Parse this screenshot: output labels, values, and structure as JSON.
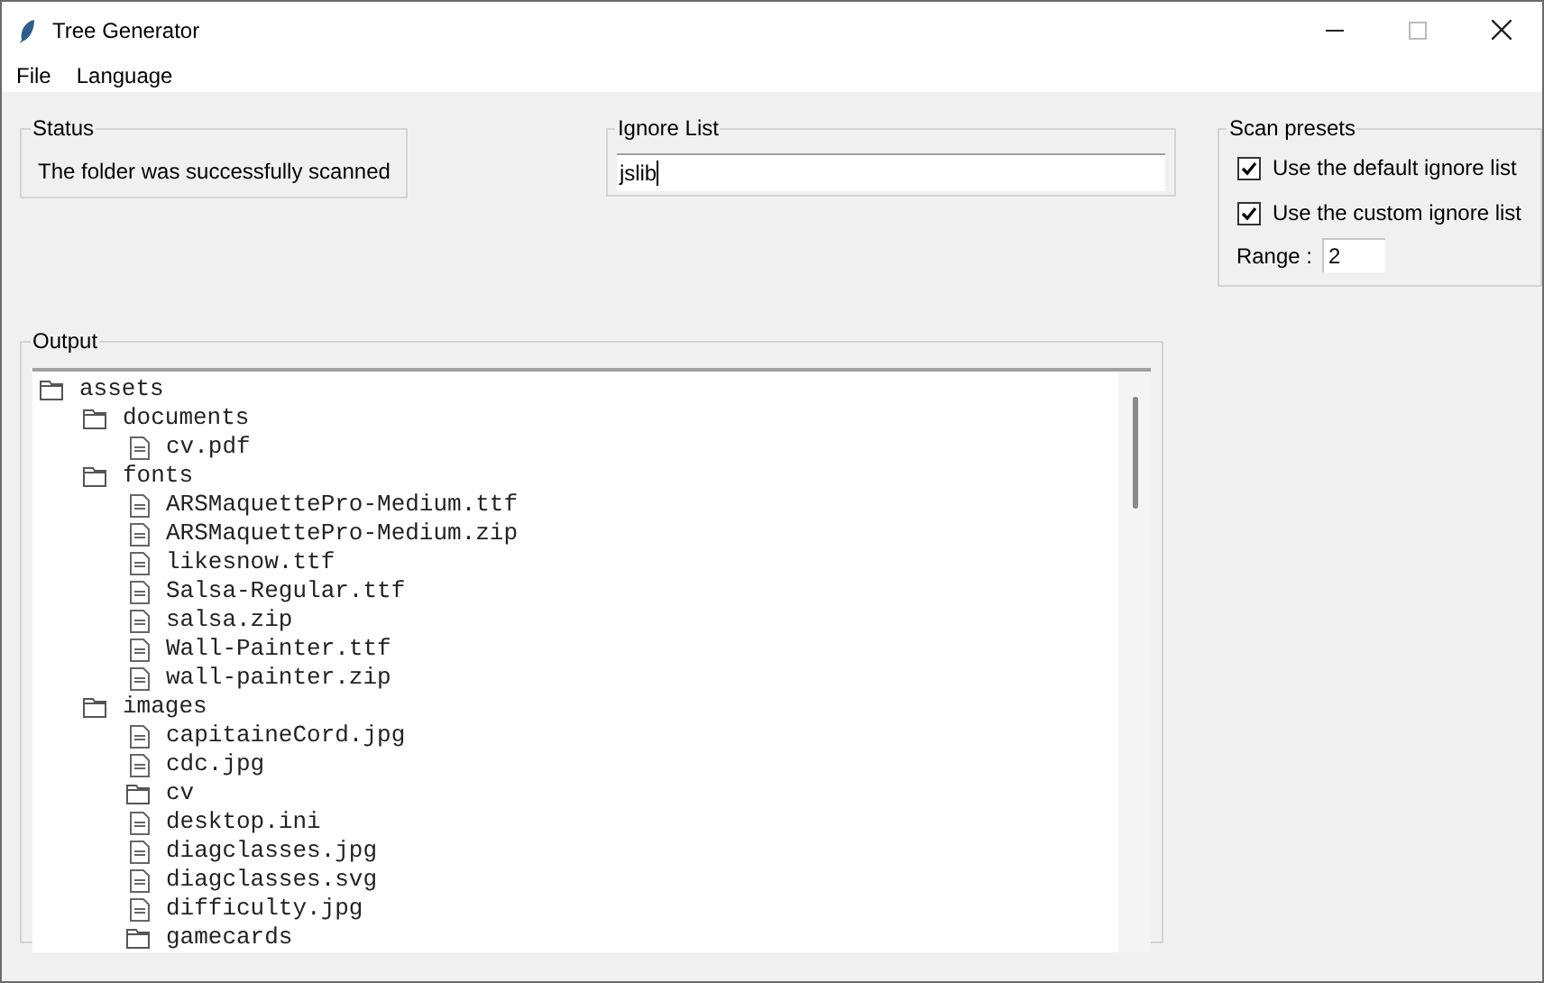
{
  "window": {
    "title": "Tree Generator"
  },
  "menu": [
    "File",
    "Language"
  ],
  "status": {
    "title": "Status",
    "message": "The folder was successfully scanned"
  },
  "ignore_list": {
    "title": "Ignore List",
    "value": "jslib"
  },
  "scan_presets": {
    "title": "Scan presets",
    "options": [
      {
        "label": "Use the default ignore list",
        "checked": true
      },
      {
        "label": "Use the custom ignore list",
        "checked": true
      }
    ],
    "range": {
      "label": "Range :",
      "value": "2"
    }
  },
  "output": {
    "title": "Output",
    "tree": [
      {
        "kind": "folder",
        "name": "assets",
        "children": [
          {
            "kind": "folder",
            "name": "documents",
            "children": [
              {
                "kind": "file",
                "name": "cv.pdf"
              }
            ]
          },
          {
            "kind": "folder",
            "name": "fonts",
            "children": [
              {
                "kind": "file",
                "name": "ARSMaquettePro-Medium.ttf"
              },
              {
                "kind": "file",
                "name": "ARSMaquettePro-Medium.zip"
              },
              {
                "kind": "file",
                "name": "likesnow.ttf"
              },
              {
                "kind": "file",
                "name": "Salsa-Regular.ttf"
              },
              {
                "kind": "file",
                "name": "salsa.zip"
              },
              {
                "kind": "file",
                "name": "Wall-Painter.ttf"
              },
              {
                "kind": "file",
                "name": "wall-painter.zip"
              }
            ]
          },
          {
            "kind": "folder",
            "name": "images",
            "children": [
              {
                "kind": "file",
                "name": "capitaineCord.jpg"
              },
              {
                "kind": "file",
                "name": "cdc.jpg"
              },
              {
                "kind": "folder",
                "name": "cv"
              },
              {
                "kind": "file",
                "name": "desktop.ini"
              },
              {
                "kind": "file",
                "name": "diagclasses.jpg"
              },
              {
                "kind": "file",
                "name": "diagclasses.svg"
              },
              {
                "kind": "file",
                "name": "difficulty.jpg"
              },
              {
                "kind": "folder",
                "name": "gamecards"
              }
            ]
          }
        ]
      }
    ]
  }
}
